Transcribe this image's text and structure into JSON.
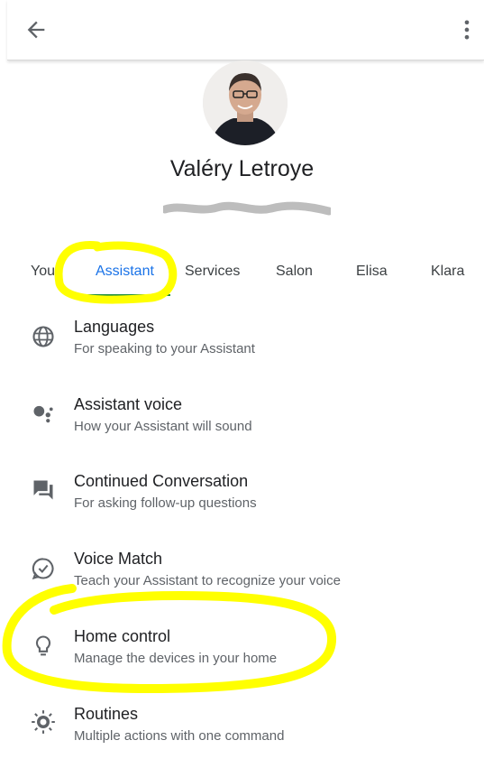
{
  "topbar": {
    "back_icon": "arrow-back-icon",
    "menu_icon": "more-vert-icon"
  },
  "profile": {
    "name": "Valéry Letroye"
  },
  "tabs": [
    {
      "label": "You"
    },
    {
      "label": "Assistant",
      "active": true
    },
    {
      "label": "Services"
    },
    {
      "label": "Salon"
    },
    {
      "label": "Elisa"
    },
    {
      "label": "Klara"
    }
  ],
  "settings": [
    {
      "title": "Languages",
      "subtitle": "For speaking to your Assistant",
      "icon": "globe-icon"
    },
    {
      "title": "Assistant voice",
      "subtitle": "How your Assistant will sound",
      "icon": "assistant-dots-icon"
    },
    {
      "title": "Continued Conversation",
      "subtitle": "For asking follow-up questions",
      "icon": "chat-bubbles-icon"
    },
    {
      "title": "Voice Match",
      "subtitle": "Teach your Assistant to recognize your voice",
      "icon": "voice-match-icon"
    },
    {
      "title": "Home control",
      "subtitle": "Manage the devices in your home",
      "icon": "lightbulb-icon"
    },
    {
      "title": "Routines",
      "subtitle": "Multiple actions with one command",
      "icon": "routines-icon"
    }
  ],
  "colors": {
    "accent": "#1a73e8",
    "indicator": "#1e8e3e",
    "highlight": "#ffff00"
  }
}
